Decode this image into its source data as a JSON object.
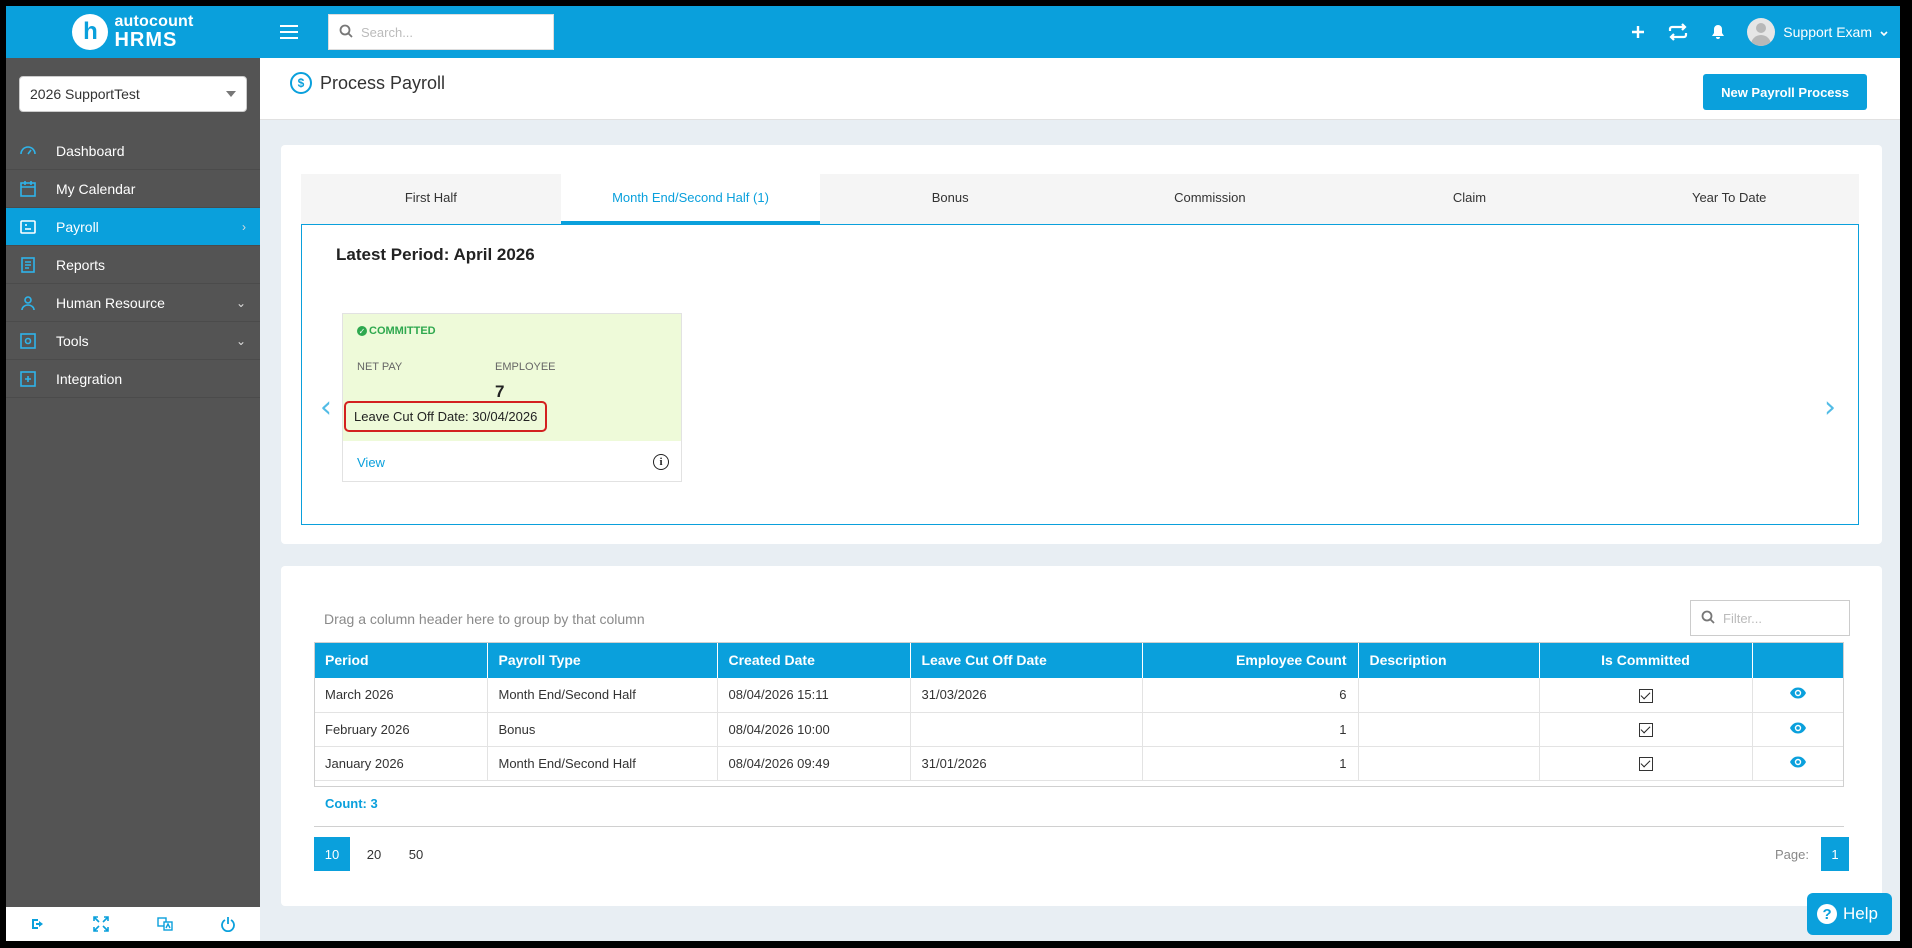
{
  "brand": {
    "top": "autocount",
    "bottom": "HRMS",
    "mark": "h"
  },
  "company": {
    "selected": "2026 SupportTest"
  },
  "sidebar": {
    "items": [
      {
        "label": "Dashboard",
        "icon": "dashboard-icon"
      },
      {
        "label": "My Calendar",
        "icon": "calendar-icon"
      },
      {
        "label": "Payroll",
        "icon": "payroll-icon",
        "active": true,
        "chevron": "›"
      },
      {
        "label": "Reports",
        "icon": "reports-icon"
      },
      {
        "label": "Human Resource",
        "icon": "human-resource-icon",
        "chevron": "⌄"
      },
      {
        "label": "Tools",
        "icon": "tools-icon",
        "chevron": "⌄"
      },
      {
        "label": "Integration",
        "icon": "integration-icon"
      }
    ],
    "footer_icons": [
      "logout-icon",
      "fullscreen-icon",
      "language-icon",
      "power-icon"
    ]
  },
  "topbar": {
    "search_placeholder": "Search...",
    "user_name": "Support Exam"
  },
  "page": {
    "title": "Process Payroll",
    "new_button": "New Payroll Process"
  },
  "tabs": [
    {
      "label": "First Half"
    },
    {
      "label": "Month End/Second Half (1)",
      "active": true
    },
    {
      "label": "Bonus"
    },
    {
      "label": "Commission"
    },
    {
      "label": "Claim"
    },
    {
      "label": "Year To Date"
    }
  ],
  "latest": {
    "title": "Latest Period: April 2026",
    "status": "COMMITTED",
    "net_pay_label": "NET PAY",
    "employee_label": "EMPLOYEE",
    "employee_value": "7",
    "leave_cut_off": "Leave Cut Off Date: 30/04/2026",
    "view_link": "View",
    "prev_arrow": "‹",
    "next_arrow": "›"
  },
  "grid": {
    "group_hint": "Drag a column header here to group by that column",
    "filter_placeholder": "Filter...",
    "columns": [
      "Period",
      "Payroll Type",
      "Created Date",
      "Leave Cut Off Date",
      "Employee Count",
      "Description",
      "Is Committed",
      ""
    ],
    "rows": [
      {
        "period": "March 2026",
        "type": "Month End/Second Half",
        "created": "08/04/2026 15:11",
        "leave_cut": "31/03/2026",
        "count": "6",
        "description": "",
        "committed": true
      },
      {
        "period": "February 2026",
        "type": "Bonus",
        "created": "08/04/2026 10:00",
        "leave_cut": "",
        "count": "1",
        "description": "",
        "committed": true
      },
      {
        "period": "January 2026",
        "type": "Month End/Second Half",
        "created": "08/04/2026 09:49",
        "leave_cut": "31/01/2026",
        "count": "1",
        "description": "",
        "committed": true
      }
    ],
    "count_label": "Count: 3"
  },
  "pager": {
    "sizes": [
      "10",
      "20",
      "50"
    ],
    "page_label": "Page:",
    "current_page": "1"
  },
  "help": {
    "label": "Help",
    "mark": "?"
  },
  "colors": {
    "accent": "#0aa0dc",
    "sidebar": "#545454",
    "committed": "#2ea84e",
    "highlight": "#d32020"
  }
}
